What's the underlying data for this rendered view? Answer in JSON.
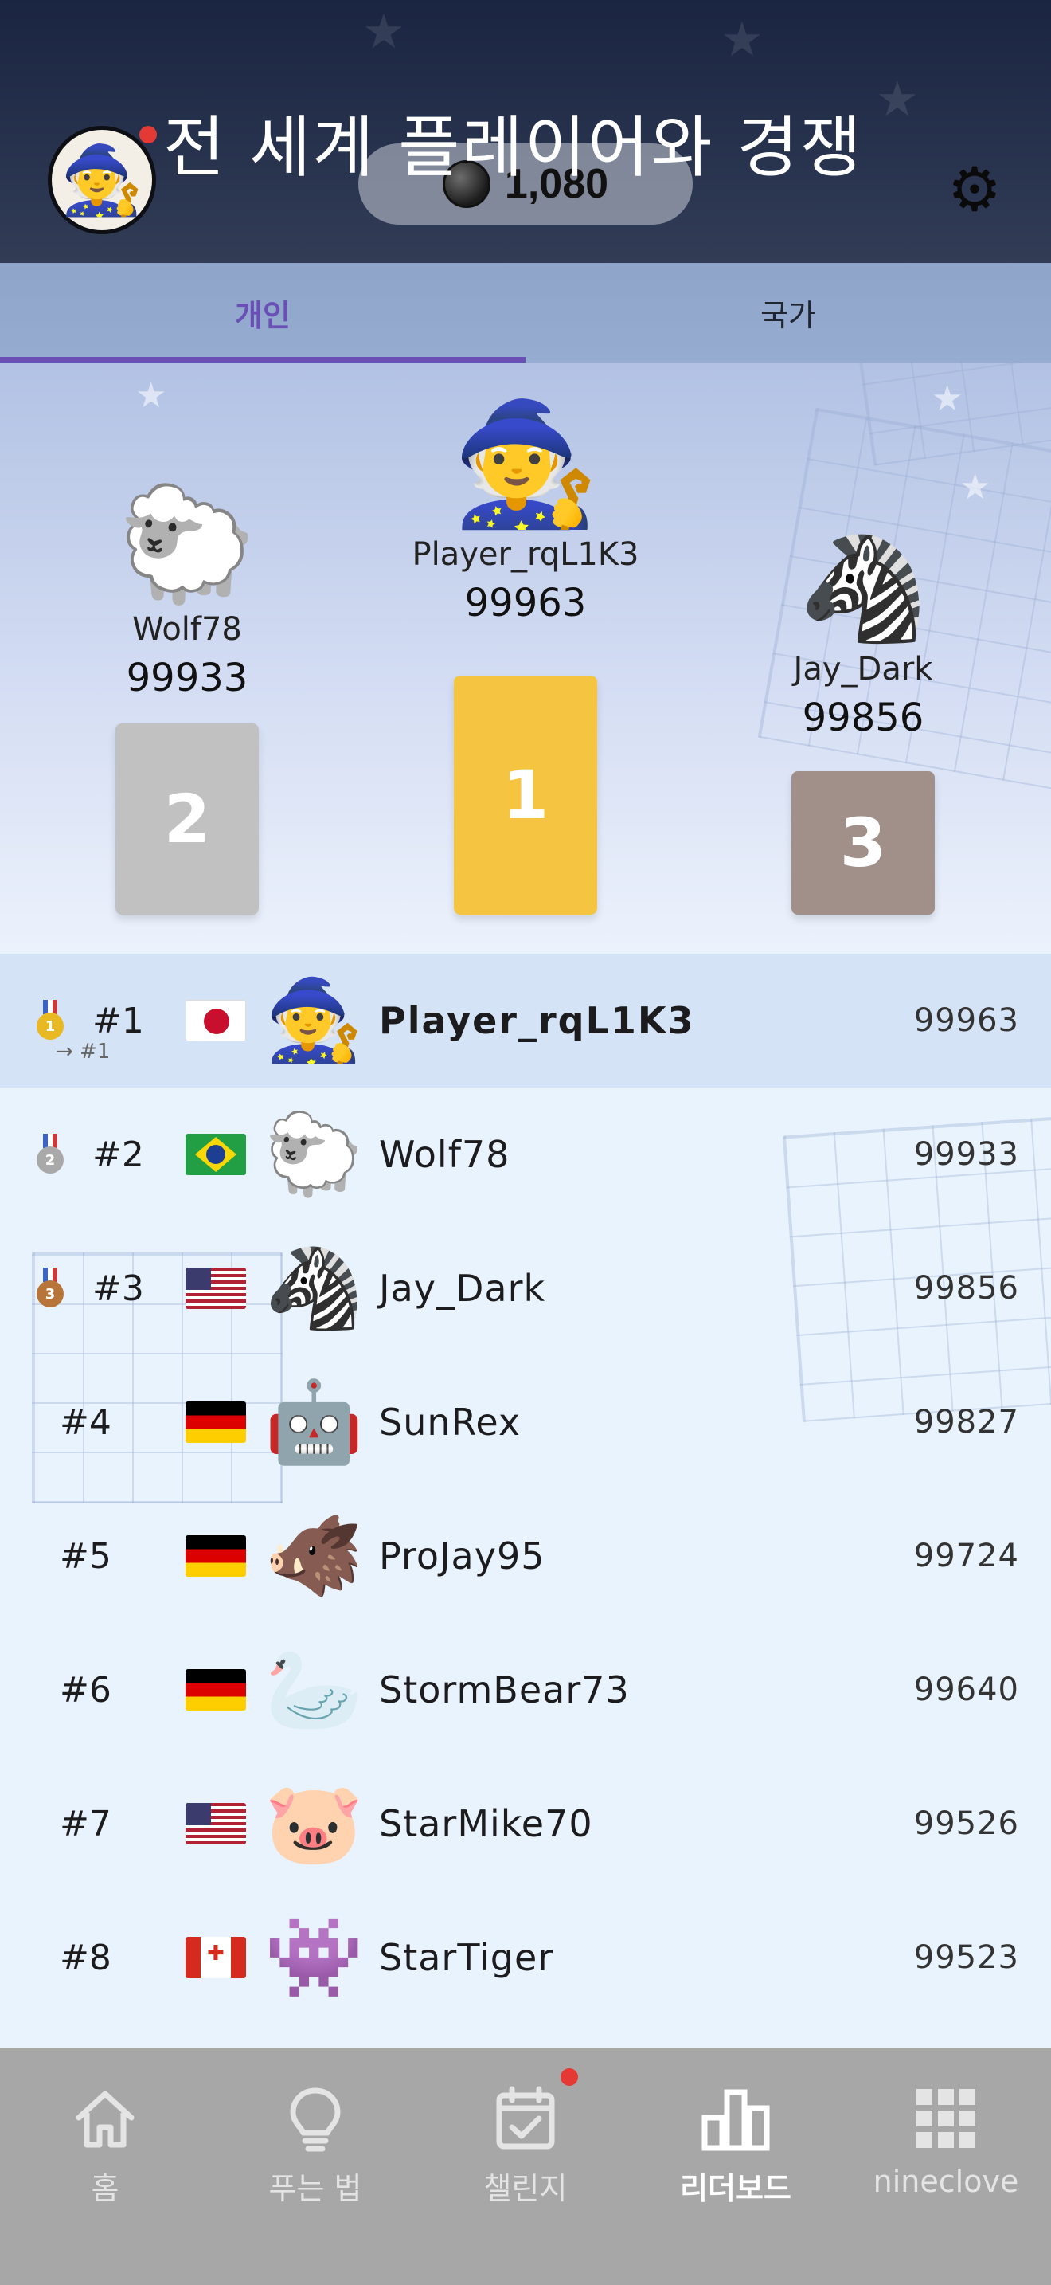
{
  "header": {
    "title": "전 세계 플레이어와 경쟁",
    "coins": "1,080",
    "avatar_icon": "witch-emoji",
    "settings_icon": "gear-icon"
  },
  "tabs": [
    {
      "label": "개인",
      "active": true
    },
    {
      "label": "국가",
      "active": false
    }
  ],
  "podium": [
    {
      "place": "2",
      "name": "Wolf78",
      "score": "99933",
      "emoji": "🐑",
      "color": "#c1c1c1"
    },
    {
      "place": "1",
      "name": "Player_rqL1K3",
      "score": "99963",
      "emoji": "🧙",
      "color": "#f5c542"
    },
    {
      "place": "3",
      "name": "Jay_Dark",
      "score": "99856",
      "emoji": "🦓",
      "color": "#a1908a"
    }
  ],
  "leaderboard": [
    {
      "rank": "#1",
      "rank_change": "→ #1",
      "medal": "gold",
      "flag": "jp",
      "emoji": "🧙",
      "name": "Player_rqL1K3",
      "score": "99963",
      "is_me": true
    },
    {
      "rank": "#2",
      "medal": "silver",
      "flag": "br",
      "emoji": "🐑",
      "name": "Wolf78",
      "score": "99933"
    },
    {
      "rank": "#3",
      "medal": "bronze",
      "flag": "us",
      "emoji": "🦓",
      "name": "Jay_Dark",
      "score": "99856"
    },
    {
      "rank": "#4",
      "flag": "de",
      "emoji": "🤖",
      "name": "SunRex",
      "score": "99827"
    },
    {
      "rank": "#5",
      "flag": "de",
      "emoji": "🐗",
      "name": "ProJay95",
      "score": "99724"
    },
    {
      "rank": "#6",
      "flag": "de",
      "emoji": "🦢",
      "name": "StormBear73",
      "score": "99640"
    },
    {
      "rank": "#7",
      "flag": "us",
      "emoji": "🐷",
      "name": "StarMike70",
      "score": "99526"
    },
    {
      "rank": "#8",
      "flag": "ca",
      "emoji": "👾",
      "name": "StarTiger",
      "score": "99523"
    }
  ],
  "nav": [
    {
      "label": "홈",
      "icon": "home-icon"
    },
    {
      "label": "푸는 법",
      "icon": "lightbulb-icon"
    },
    {
      "label": "챌린지",
      "icon": "calendar-check-icon",
      "badge": true
    },
    {
      "label": "리더보드",
      "icon": "bar-chart-icon",
      "active": true
    },
    {
      "label": "nineclove",
      "icon": "grid-icon"
    }
  ],
  "colors": {
    "accent": "#6a4fb7",
    "gold": "#f5c542",
    "silver": "#c1c1c1",
    "bronze": "#a1908a",
    "badge_red": "#e53935"
  }
}
